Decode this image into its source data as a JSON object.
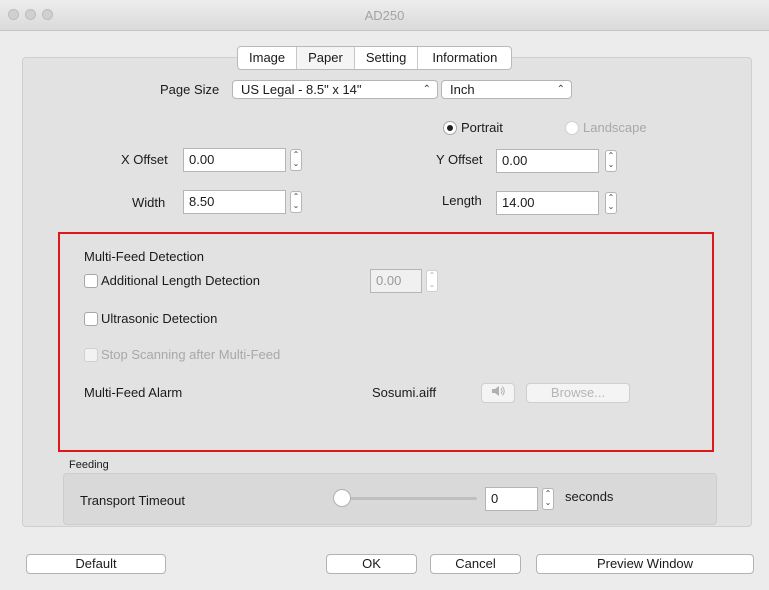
{
  "window": {
    "title": "AD250"
  },
  "tabs": [
    {
      "label": "Image"
    },
    {
      "label": "Paper"
    },
    {
      "label": "Setting"
    },
    {
      "label": "Information"
    }
  ],
  "paper": {
    "page_size_label": "Page Size",
    "page_size_value": "US Legal - 8.5\" x 14\"",
    "unit_value": "Inch",
    "orientation": {
      "portrait_label": "Portrait",
      "landscape_label": "Landscape",
      "selected": "Portrait"
    },
    "x_offset_label": "X Offset",
    "x_offset_value": "0.00",
    "y_offset_label": "Y Offset",
    "y_offset_value": "0.00",
    "width_label": "Width",
    "width_value": "8.50",
    "length_label": "Length",
    "length_value": "14.00"
  },
  "multifeed": {
    "heading": "Multi-Feed Detection",
    "additional_length_label": "Additional Length Detection",
    "additional_length_checked": false,
    "additional_length_value": "0.00",
    "ultrasonic_label": "Ultrasonic Detection",
    "ultrasonic_checked": false,
    "stop_scanning_label": "Stop Scanning after Multi-Feed",
    "stop_scanning_enabled": false,
    "alarm_label": "Multi-Feed Alarm",
    "alarm_value": "Sosumi.aiff",
    "browse_label": "Browse..."
  },
  "feeding": {
    "section_label": "Feeding",
    "timeout_label": "Transport Timeout",
    "timeout_value": "0",
    "timeout_unit": "seconds",
    "slider_level": 0
  },
  "buttons": {
    "default_label": "Default",
    "ok_label": "OK",
    "cancel_label": "Cancel",
    "preview_label": "Preview Window"
  },
  "icons": {
    "traffic_lights": [
      "close-icon",
      "minimize-icon",
      "zoom-icon"
    ],
    "select_arrow": "updown-chevron-icon",
    "stepper": "stepper-arrows-icon",
    "speaker": "speaker-icon"
  }
}
